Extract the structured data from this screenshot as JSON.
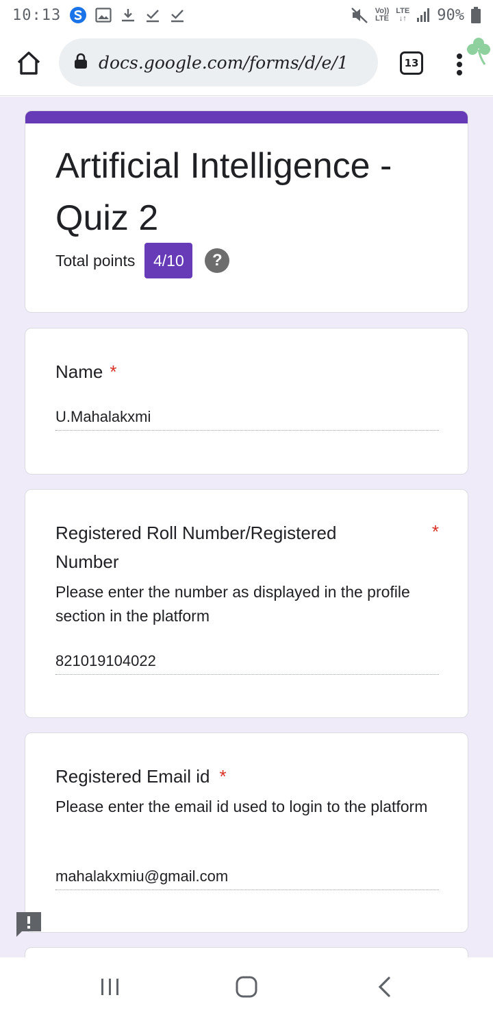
{
  "status_bar": {
    "time": "10:13",
    "volte_top": "Vo))",
    "volte_bottom": "LTE",
    "lte_top": "LTE",
    "lte_bottom": "↓↑",
    "battery": "90%"
  },
  "browser": {
    "url": "docs.google.com/forms/d/e/1",
    "tab_count": "13"
  },
  "form": {
    "title": "Artificial Intelligence - Quiz 2",
    "total_points_label": "Total points",
    "score": "4/10",
    "help_symbol": "?"
  },
  "questions": [
    {
      "title": "Name",
      "required_mark": "*",
      "answer": "U.Mahalakxmi"
    },
    {
      "title": "Registered Roll Number/Registered Number",
      "required_mark": "*",
      "description": "Please enter the number as displayed in the profile section in the platform",
      "answer": "821019104022"
    },
    {
      "title": "Registered Email id",
      "required_mark": "*",
      "description": "Please enter the email id used to login to the platform",
      "answer": "mahalakxmiu@gmail.com"
    }
  ],
  "colors": {
    "accent": "#673ab7",
    "background": "#f0ebf8",
    "required": "#d93025"
  },
  "icons": [
    "home-icon",
    "lock-icon",
    "tab-switcher-icon",
    "more-vert-icon",
    "help-icon",
    "feedback-icon",
    "recents-icon",
    "home-nav-icon",
    "back-icon"
  ]
}
